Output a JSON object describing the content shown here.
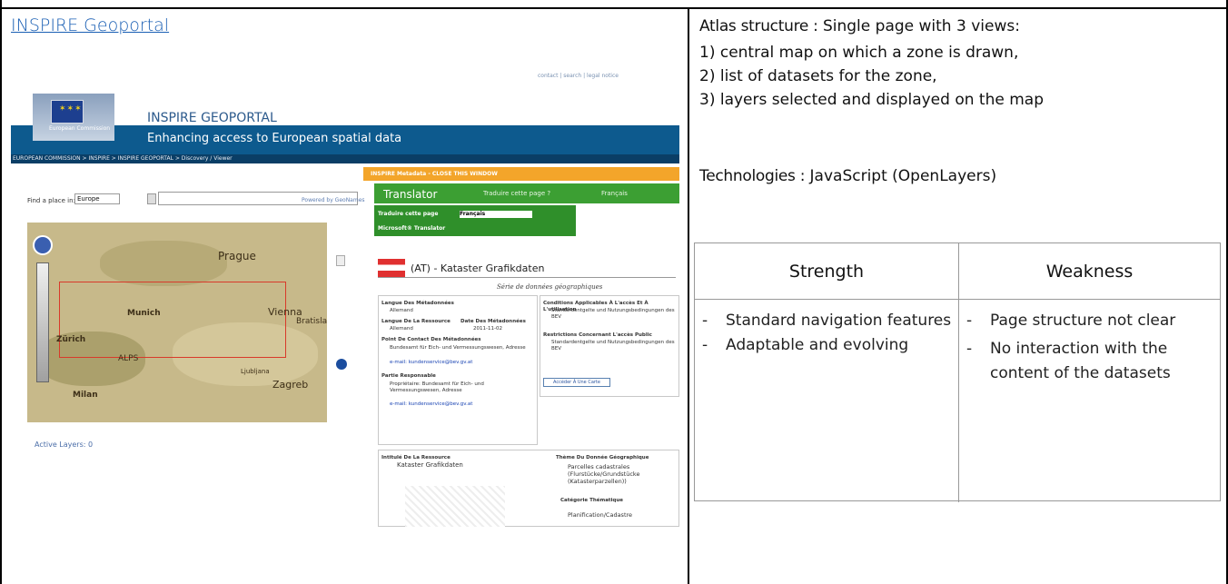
{
  "left": {
    "link": "INSPIRE Geoportal",
    "screenshot": {
      "header_title": "INSPIRE GEOPORTAL",
      "header_sub": "Enhancing access to European spatial data",
      "eu_label": "European Commission",
      "breadcrumb": "EUROPEAN COMMISSION > INSPIRE > INSPIRE GEOPORTAL > Discovery / Viewer",
      "find_label": "Find a place in:",
      "find_value": "Europe",
      "powered": "Powered by GeoNames",
      "active_layers": "Active Layers: 0",
      "cities": [
        "Prague",
        "Munich",
        "Vienna",
        "Bratislava",
        "Zürich",
        "Milan",
        "Zagreb",
        "ALPS",
        "Ljubljana"
      ],
      "meta_bar": "INSPIRE Metadata - CLOSE THIS WINDOW",
      "translator": "Translator",
      "translate_page": "Traduire cette page ?",
      "lang": "Français",
      "translate_bar": "Traduire cette page",
      "translate_lang": "Français",
      "ms_translator": "Microsoft® Translator",
      "doc_title": "(AT) - Kataster Grafikdaten",
      "doc_sub": "Série de données géographiques",
      "lang_meta_label": "Langue Des Métadonnées",
      "lang_meta_value": "Allemand",
      "lang_res_label": "Langue De La Ressource",
      "lang_res_value": "Allemand",
      "date_label": "Date Des Métadonnées",
      "date_value": "2011-11-02",
      "contact_label": "Point De Contact Des Métadonnées",
      "contact_value": "Bundesamt für Eich- und Vermessungswesen, Adresse",
      "email": "e-mail: kundenservice@bev.gv.at",
      "party_label": "Partie Responsable",
      "party_value": "Propriétaire: Bundesamt für Eich- und Vermessungswesen, Adresse",
      "cond_label": "Conditions Applicables À L'accès Et À L'utilisation",
      "cond_value": "Standardentgelte und Nutzungsbedingungen des BEV",
      "restr_label": "Restrictions Concernant L'accès Public",
      "restr_value": "Standardentgelte und Nutzungsbedingungen des BEV",
      "map_button": "Accéder À Une Carte",
      "title_label": "Intitulé De La Ressource",
      "title_value": "Kataster Grafikdaten",
      "theme_label": "Thème Du Donnée Géographique",
      "theme_value": "Parcelles cadastrales (Flurstücke/Grundstücke (Katasterparzellen))",
      "cat_label": "Catégorie Thématique",
      "cat_value": "Planification/Cadastre"
    }
  },
  "right": {
    "structure_label": "Atlas structure :",
    "structure_text": " Single page with 3 views:",
    "views": [
      "1) central map on which a zone is drawn,",
      "2) list of datasets for the zone,",
      "3) layers selected and displayed on the map"
    ],
    "tech_label": "Technologies :",
    "tech_text": " JavaScript (OpenLayers)",
    "table": {
      "col1": "Strength",
      "col2": "Weakness",
      "strengths": [
        "Standard navigation features",
        "Adaptable and evolving"
      ],
      "weaknesses": [
        "Page structure not clear",
        "No interaction with the content of the datasets"
      ]
    }
  },
  "colors": {
    "link": "#1a5fb4",
    "banner": "#0d5a8e",
    "translator": "#3c9f33",
    "meta_bar": "#f3a52a",
    "zone": "#d83a2a"
  }
}
